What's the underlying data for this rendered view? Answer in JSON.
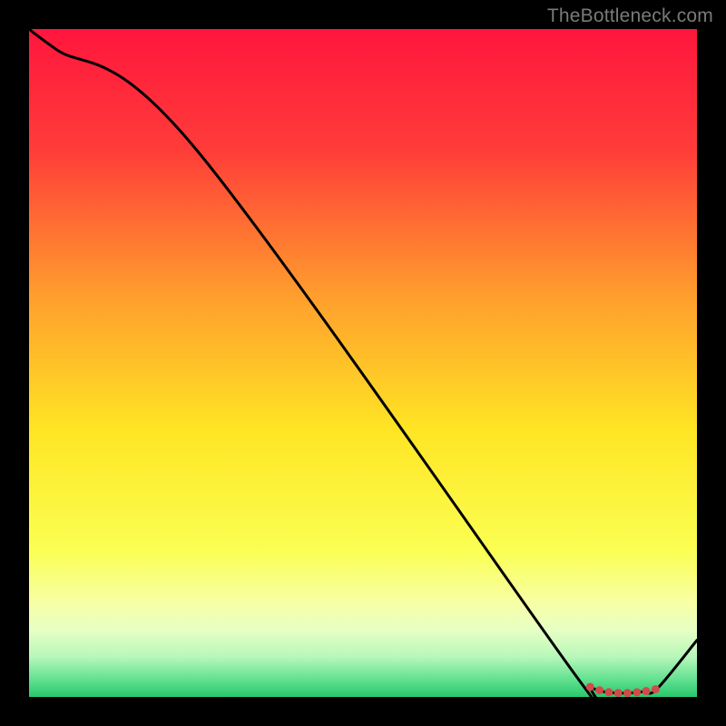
{
  "attribution": "TheBottleneck.com",
  "chart_data": {
    "type": "line",
    "title": "",
    "xlabel": "",
    "ylabel": "",
    "xlim": [
      0,
      100
    ],
    "ylim": [
      0,
      100
    ],
    "x": [
      0,
      4,
      25,
      82,
      84,
      86,
      88,
      90,
      92,
      94,
      100
    ],
    "values": [
      100,
      97,
      82,
      3,
      1.5,
      0.8,
      0.6,
      0.6,
      0.8,
      1.2,
      8.5
    ],
    "curve_color": "#000000",
    "background_gradient": [
      {
        "offset": 0.0,
        "color": "#ff163d"
      },
      {
        "offset": 0.18,
        "color": "#ff3c39"
      },
      {
        "offset": 0.4,
        "color": "#ff9e2d"
      },
      {
        "offset": 0.6,
        "color": "#ffe524"
      },
      {
        "offset": 0.78,
        "color": "#fbff52"
      },
      {
        "offset": 0.86,
        "color": "#f7ffa6"
      },
      {
        "offset": 0.9,
        "color": "#e6ffc4"
      },
      {
        "offset": 0.94,
        "color": "#b8f7ba"
      },
      {
        "offset": 0.975,
        "color": "#5fe08f"
      },
      {
        "offset": 1.0,
        "color": "#28c76b"
      }
    ],
    "markers": {
      "color": "#d24a4a",
      "radius": 4.5,
      "x": [
        84.0,
        85.4,
        86.8,
        88.2,
        89.6,
        91.0,
        92.4,
        93.8
      ]
    }
  }
}
